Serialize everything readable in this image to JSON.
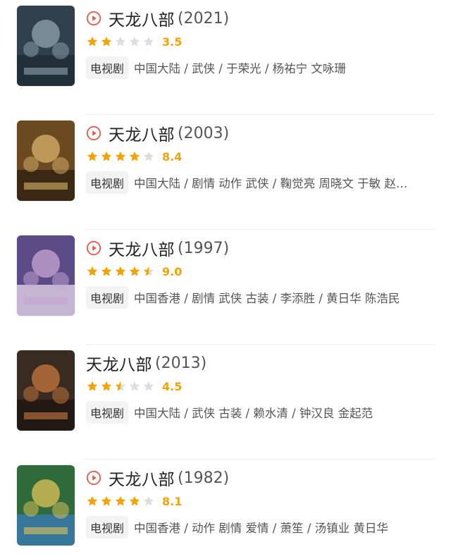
{
  "colors": {
    "accent": "#e85a4f",
    "star_full": "#f4a300",
    "star_empty": "#dedede"
  },
  "items": [
    {
      "title": "天龙八部",
      "year": "(2021)",
      "has_play": true,
      "stars": 2,
      "score": "3.5",
      "badge": "电视剧",
      "meta": "中国大陆 / 武侠 / 于荣光 / 杨祐宁 文咏珊",
      "poster_palette": [
        "#30404d",
        "#8fa4ad",
        "#1d2a33"
      ]
    },
    {
      "title": "天龙八部",
      "year": "(2003)",
      "has_play": true,
      "stars": 4,
      "score": "8.4",
      "badge": "电视剧",
      "meta": "中国大陆 / 剧情 动作 武侠 / 鞠觉亮 周晓文 于敏 赵…",
      "poster_palette": [
        "#6b4a22",
        "#d9b36b",
        "#2b1d10"
      ]
    },
    {
      "title": "天龙八部",
      "year": "(1997)",
      "has_play": true,
      "stars": 4.5,
      "score": "9.0",
      "badge": "电视剧",
      "meta": "中国香港 / 剧情 武侠 古装 / 李添胜 / 黄日华 陈浩民",
      "poster_palette": [
        "#5b4b86",
        "#c7a7d6",
        "#e9d7ef"
      ]
    },
    {
      "title": "天龙八部",
      "year": "(2013)",
      "has_play": false,
      "stars": 2.5,
      "score": "4.5",
      "badge": "电视剧",
      "meta": "中国大陆 / 武侠 古装 / 赖水清 / 钟汉良 金起范",
      "poster_palette": [
        "#3a2b22",
        "#c8793d",
        "#1b1410"
      ]
    },
    {
      "title": "天龙八部",
      "year": "(1982)",
      "has_play": true,
      "stars": 4,
      "score": "8.1",
      "badge": "电视剧",
      "meta": "中国香港 / 动作 剧情 爱情 / 萧笙 / 汤镇业 黄日华",
      "poster_palette": [
        "#2f6a3a",
        "#e2c35a",
        "#3a7bb8"
      ]
    }
  ]
}
